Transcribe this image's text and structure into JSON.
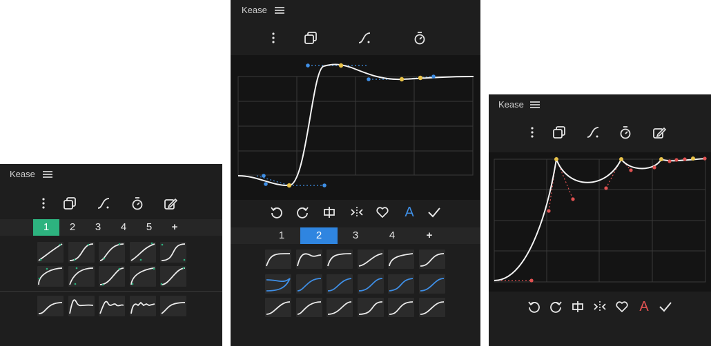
{
  "app": {
    "title": "Kease"
  },
  "left_panel": {
    "title": "Kease",
    "toolbar": [
      "more-vertical-icon",
      "copy-icon",
      "curve-icon",
      "stopwatch-icon",
      "edit-icon"
    ],
    "tabs": [
      "1",
      "2",
      "3",
      "4",
      "5",
      "+"
    ],
    "active_tab": "1"
  },
  "center_panel": {
    "title": "Kease",
    "toolbar": [
      "more-vertical-icon",
      "copy-icon",
      "curve-icon",
      "stopwatch-icon"
    ],
    "actions": [
      "undo-icon",
      "redo-icon",
      "clip-icon",
      "mirror-icon",
      "heart-icon",
      "A",
      "check-icon"
    ],
    "action_label": "A",
    "tabs": [
      "1",
      "2",
      "3",
      "4",
      "+"
    ],
    "active_tab": "2"
  },
  "right_panel": {
    "title": "Kease",
    "toolbar": [
      "more-vertical-icon",
      "copy-icon",
      "curve-icon",
      "stopwatch-icon",
      "edit-icon"
    ],
    "action_label": "A"
  },
  "colors": {
    "panel": "#1e1e1e",
    "graph": "#141414",
    "green": "#2db37f",
    "blue": "#2f85e0",
    "red": "#e05252",
    "handle_blue": "#3f8fe6",
    "handle_yellow": "#e8c24a"
  }
}
